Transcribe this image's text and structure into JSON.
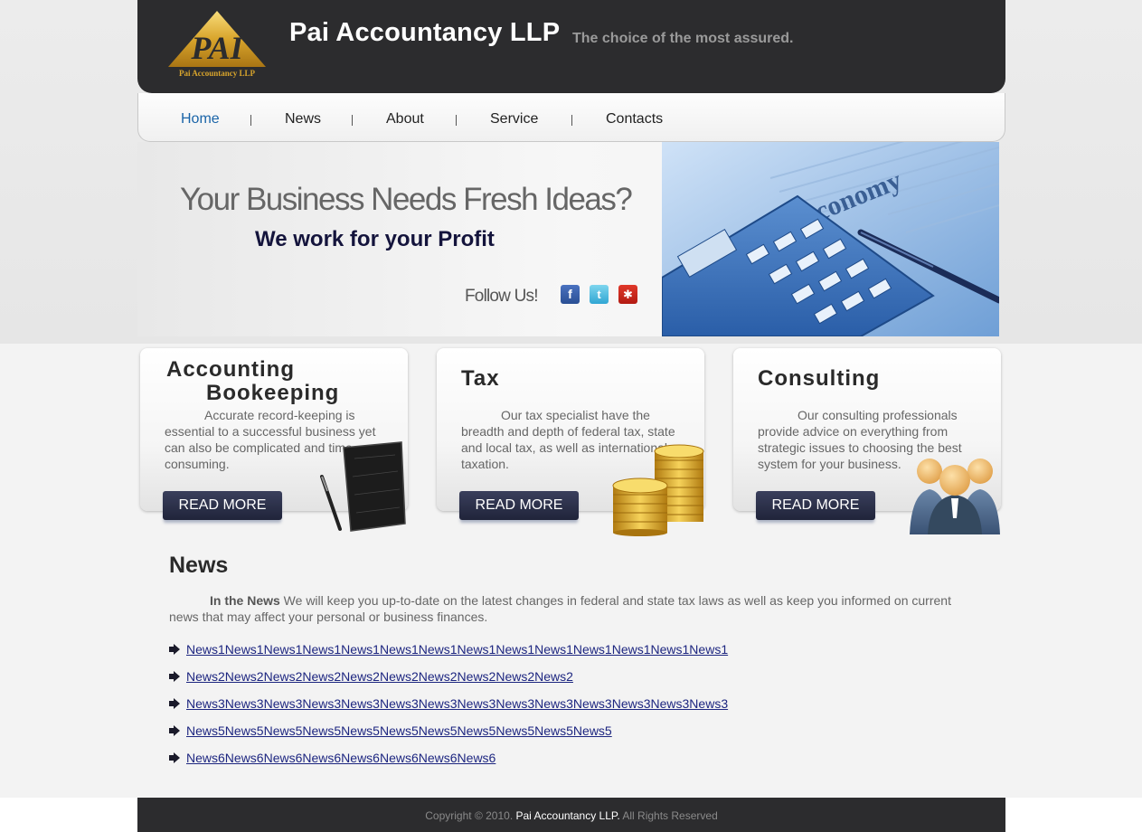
{
  "header": {
    "logo_text": "PAI",
    "logo_subtext": "Pai Accountancy LLP",
    "title": "Pai Accountancy LLP",
    "tagline": "The choice of the most assured."
  },
  "nav": {
    "items": [
      {
        "label": "Home",
        "active": true
      },
      {
        "label": "News",
        "active": false
      },
      {
        "label": "About",
        "active": false
      },
      {
        "label": "Service",
        "active": false
      },
      {
        "label": "Contacts",
        "active": false
      }
    ]
  },
  "banner": {
    "headline": "Your Business Needs Fresh Ideas?",
    "subline": "We work for your Profit",
    "follow_label": "Follow Us!",
    "social": [
      "facebook-icon",
      "twitter-icon",
      "yelp-icon"
    ],
    "photo_text": "bal economy"
  },
  "services": [
    {
      "title_line1": "Accounting",
      "title_line2": "Bookeeping",
      "body": "Accurate record-keeping is essential to a successful business yet can also be complicated and time-consuming.",
      "button": "READ MORE",
      "icon": "notebook-icon"
    },
    {
      "title_line1": "Tax",
      "body": "Our tax specialist have the breadth and depth of federal tax, state and local tax, as well as international taxation.",
      "button": "READ MORE",
      "icon": "coins-icon"
    },
    {
      "title_line1": "Consulting",
      "body": "Our consulting professionals provide advice on everything from strategic issues to choosing the best system for your business.",
      "button": "READ MORE",
      "icon": "people-icon"
    }
  ],
  "news": {
    "title": "News",
    "intro_bold": "In the News",
    "intro_text": " We will keep you up-to-date on the latest changes in federal and state tax laws as well as keep you informed on current news that may affect your personal or business finances.",
    "items": [
      "News1News1News1News1News1News1News1News1News1News1News1News1News1News1",
      "News2News2News2News2News2News2News2News2News2News2",
      "News3News3News3News3News3News3News3News3News3News3News3News3News3News3",
      "News5News5News5News5News5News5News5News5News5News5News5",
      "News6News6News6News6News6News6News6News6"
    ]
  },
  "footer": {
    "prefix": "Copyright © 2010.",
    "brand": "Pai Accountancy LLP.",
    "suffix": "All Rights Reserved"
  },
  "colors": {
    "header_bg": "#2c2c2e",
    "nav_active": "#1a64a8",
    "link": "#1d2680",
    "button_bg": "#2a2e48"
  }
}
